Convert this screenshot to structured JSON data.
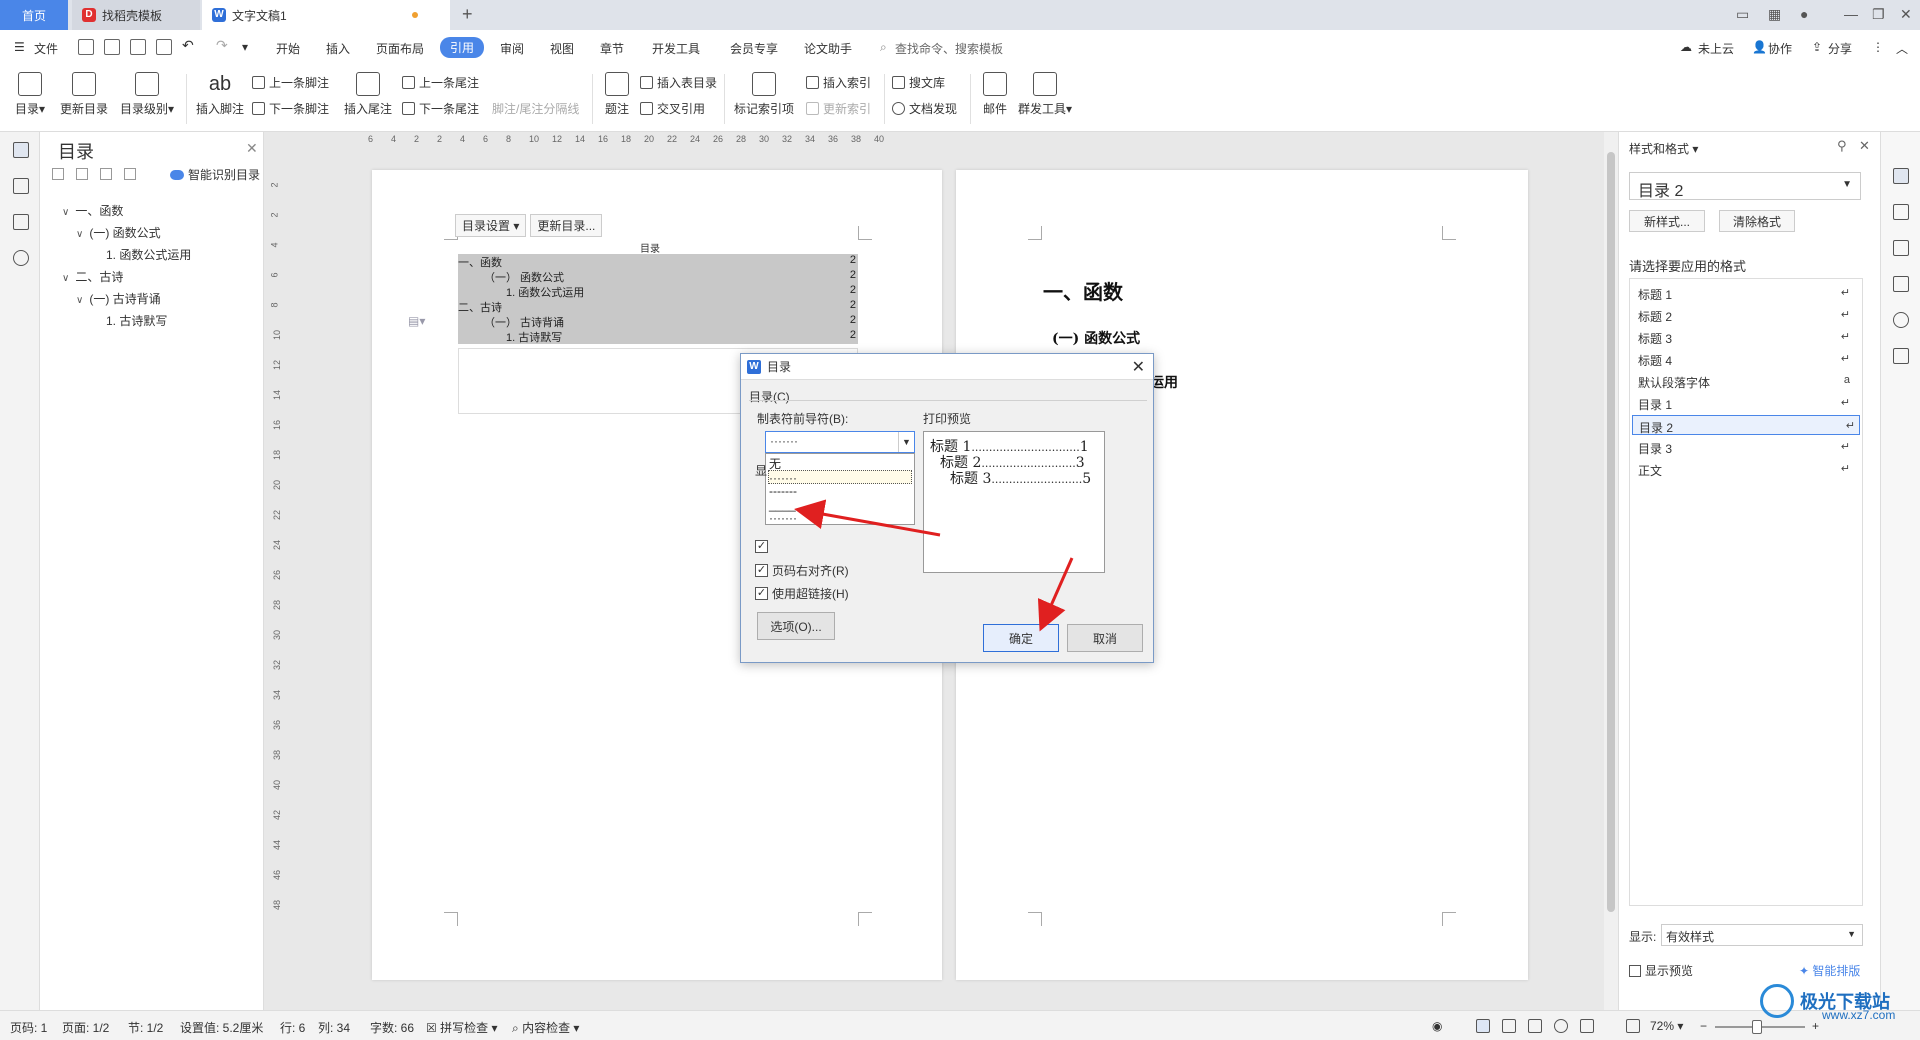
{
  "titlebar": {
    "tabs": [
      {
        "label": "首页"
      },
      {
        "label": "找稻壳模板"
      },
      {
        "label": "文字文稿1"
      }
    ],
    "add_tab": "+"
  },
  "menubar": {
    "file": "文件",
    "items": [
      "开始",
      "插入",
      "页面布局",
      "引用",
      "审阅",
      "视图",
      "章节",
      "开发工具",
      "会员专享",
      "论文助手"
    ],
    "active": "引用",
    "search_placeholder": "查找命令、搜索模板",
    "cloud": "未上云",
    "collab": "协作",
    "share": "分享"
  },
  "ribbon": {
    "toc": "目录",
    "update_toc": "更新目录",
    "toc_level": "目录级别",
    "insert_footnote": "插入脚注",
    "prev_footnote": "上一条脚注",
    "next_footnote": "下一条脚注",
    "insert_endnote": "插入尾注",
    "prev_endnote": "上一条尾注",
    "next_endnote": "下一条尾注",
    "note_separator": "脚注/尾注分隔线",
    "caption": "题注",
    "insert_table_of_figures": "插入表目录",
    "cross_ref": "交叉引用",
    "mark_index": "标记索引项",
    "insert_index": "插入索引",
    "update_index": "更新索引",
    "search_lib": "搜文库",
    "doc_check": "文档发现",
    "mail": "邮件",
    "mass_tool": "群发工具"
  },
  "toc_panel": {
    "title": "目录",
    "smart": "智能识别目录",
    "items": [
      {
        "label": "一、函数",
        "level": 1
      },
      {
        "label": "(一) 函数公式",
        "level": 2
      },
      {
        "label": "1.  函数公式运用",
        "level": 3
      },
      {
        "label": "二、古诗",
        "level": 1
      },
      {
        "label": "(一) 古诗背诵",
        "level": 2
      },
      {
        "label": "1.  古诗默写",
        "level": 3
      }
    ]
  },
  "ruler": {
    "h_ticks": [
      "6",
      "4",
      "2",
      "2",
      "4",
      "6",
      "8",
      "10",
      "12",
      "14",
      "16",
      "18",
      "20",
      "22",
      "24",
      "26",
      "28",
      "30",
      "32",
      "34",
      "36",
      "38",
      "40"
    ],
    "v_ticks": [
      "2",
      "2",
      "4",
      "6",
      "8",
      "10",
      "12",
      "14",
      "16",
      "18",
      "20",
      "22",
      "24",
      "26",
      "28",
      "30",
      "32",
      "34",
      "36",
      "38",
      "40",
      "42",
      "44",
      "46",
      "48"
    ]
  },
  "doc": {
    "toc_settings": "目录设置",
    "update_toc": "更新目录...",
    "toc_heading": "目录",
    "toc_lines": [
      {
        "text": "一、函数",
        "page": "2",
        "level": 1
      },
      {
        "text": "（一）  函数公式",
        "page": "2",
        "level": 2
      },
      {
        "text": "1.   函数公式运用",
        "page": "2",
        "level": 3
      },
      {
        "text": "二、古诗",
        "page": "2",
        "level": 1
      },
      {
        "text": "（一）  古诗背诵",
        "page": "2",
        "level": 2
      },
      {
        "text": "1.   古诗默写",
        "page": "2",
        "level": 3
      }
    ],
    "page2_h1": "一、函数",
    "page2_h2": "(一) 函数公式",
    "page2_h3_partial": "运用"
  },
  "dialog": {
    "title": "目录",
    "group": "目录(C)",
    "leader_label": "制表符前导符(B):",
    "leader_value": "·······",
    "leader_options": [
      "无",
      "·······",
      "-------",
      "____",
      "·······"
    ],
    "show_label_partial": "显",
    "right_align": "页码右对齐(R)",
    "hyperlink": "使用超链接(H)",
    "options_btn": "选项(O)...",
    "preview_label": "打印预览",
    "preview_lines": [
      {
        "text": "标题 1",
        "leader": "...............................",
        "page": "1"
      },
      {
        "text": "标题 2",
        "leader": "...........................",
        "page": "3"
      },
      {
        "text": "标题 3",
        "leader": "..........................",
        "page": "5"
      }
    ],
    "ok": "确定",
    "cancel": "取消"
  },
  "style_panel": {
    "title": "样式和格式",
    "current": "目录 2",
    "new_style": "新样式...",
    "clear_format": "清除格式",
    "label": "请选择要应用的格式",
    "styles": [
      "标题 1",
      "标题 2",
      "标题 3",
      "标题 4",
      "默认段落字体",
      "目录 1",
      "目录 2",
      "目录 3",
      "正文"
    ],
    "selected": "目录 2",
    "show_label": "显示:",
    "show_value": "有效样式",
    "show_preview": "显示预览",
    "smart_layout": "智能排版"
  },
  "statusbar": {
    "page_code": "页码: 1",
    "page": "页面: 1/2",
    "section": "节: 1/2",
    "setting": "设置值: 5.2厘米",
    "row": "行: 6",
    "col": "列: 34",
    "words": "字数: 66",
    "spell": "拼写检查",
    "content_check": "内容检查",
    "zoom": "72%"
  },
  "watermark": {
    "name": "极光下载站",
    "url": "www.xz7.com"
  },
  "colors": {
    "accent": "#4a86e8",
    "arrow": "#e02020",
    "toc_highlight": "#c8c8c8"
  }
}
